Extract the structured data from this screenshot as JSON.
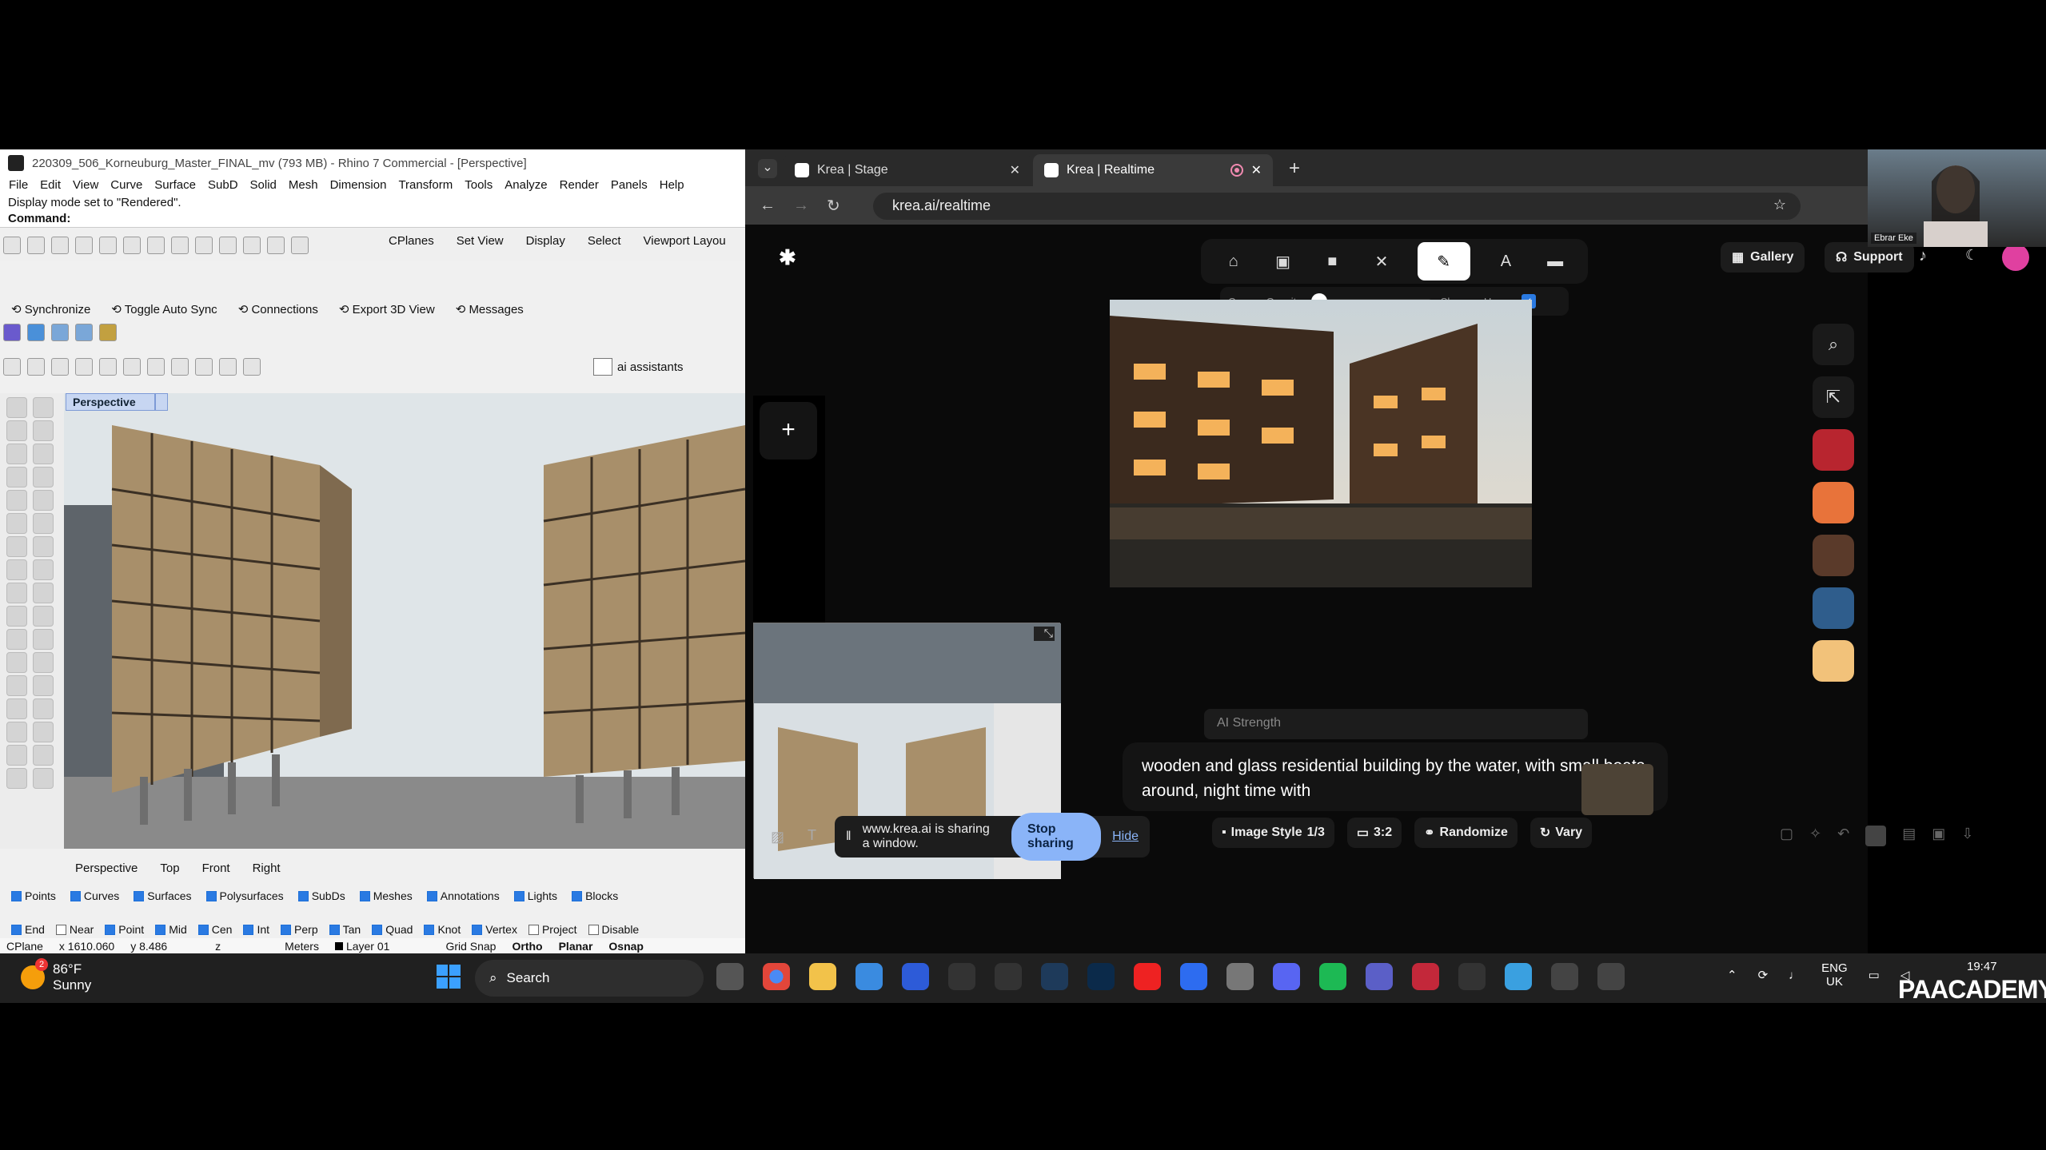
{
  "rhino": {
    "title": "220309_506_Korneuburg_Master_FINAL_mv (793 MB) - Rhino 7 Commercial - [Perspective]",
    "menu": [
      "File",
      "Edit",
      "View",
      "Curve",
      "Surface",
      "SubD",
      "Solid",
      "Mesh",
      "Dimension",
      "Transform",
      "Tools",
      "Analyze",
      "Render",
      "Panels",
      "Help"
    ],
    "command_history": "Display mode set to \"Rendered\".",
    "command_prompt": "Command:",
    "toolbar_tabs": [
      "CPlanes",
      "Set View",
      "Display",
      "Select",
      "Viewport Layou"
    ],
    "sync_toolbar": [
      "Synchronize",
      "Toggle Auto Sync",
      "Connections",
      "Export 3D View",
      "Messages"
    ],
    "ai_assistants": "ai assistants",
    "viewport_label": "Perspective",
    "viewport_tabs": [
      "Perspective",
      "Top",
      "Front",
      "Right"
    ],
    "filters": [
      {
        "label": "Points",
        "on": true
      },
      {
        "label": "Curves",
        "on": true
      },
      {
        "label": "Surfaces",
        "on": true
      },
      {
        "label": "Polysurfaces",
        "on": true
      },
      {
        "label": "SubDs",
        "on": true
      },
      {
        "label": "Meshes",
        "on": true
      },
      {
        "label": "Annotations",
        "on": true
      },
      {
        "label": "Lights",
        "on": true
      },
      {
        "label": "Blocks",
        "on": true
      }
    ],
    "osnaps": [
      {
        "label": "End",
        "on": true
      },
      {
        "label": "Near",
        "on": false
      },
      {
        "label": "Point",
        "on": true
      },
      {
        "label": "Mid",
        "on": true
      },
      {
        "label": "Cen",
        "on": true
      },
      {
        "label": "Int",
        "on": true
      },
      {
        "label": "Perp",
        "on": true
      },
      {
        "label": "Tan",
        "on": true
      },
      {
        "label": "Quad",
        "on": true
      },
      {
        "label": "Knot",
        "on": true
      },
      {
        "label": "Vertex",
        "on": true
      },
      {
        "label": "Project",
        "on": false
      },
      {
        "label": "Disable",
        "on": false
      }
    ],
    "status": {
      "cplane": "CPlane",
      "x": "x 1610.060",
      "y": "y 8.486",
      "z": "z",
      "units": "Meters",
      "layer": "Layer 01",
      "grid_snap": "Grid Snap",
      "ortho": "Ortho",
      "planar": "Planar",
      "osnap": "Osnap"
    }
  },
  "browser": {
    "tabs": [
      {
        "label": "Krea | Stage"
      },
      {
        "label": "Krea | Realtime"
      }
    ],
    "url": "krea.ai/realtime"
  },
  "krea": {
    "gallery": "Gallery",
    "support": "Support",
    "canvas_opacity": "Canvas Opacity",
    "show_on_hover": "Show on Hover",
    "ai_strength": "AI Strength",
    "prompt": "wooden and glass residential building by the water, with small boats around, night time with",
    "share_notice": "www.krea.ai is sharing a window.",
    "stop_sharing": "Stop sharing",
    "hide": "Hide",
    "image_style": "Image Style",
    "image_style_count": "1/3",
    "aspect": "3:2",
    "randomize": "Randomize",
    "vary": "Vary"
  },
  "webcam": {
    "name": "Ebrar Eke"
  },
  "taskbar": {
    "temp": "86°F",
    "weather": "Sunny",
    "weather_badge": "2",
    "search": "Search",
    "lang1": "ENG",
    "lang2": "UK",
    "time": "19:47"
  },
  "brand": "PAACADEMY"
}
